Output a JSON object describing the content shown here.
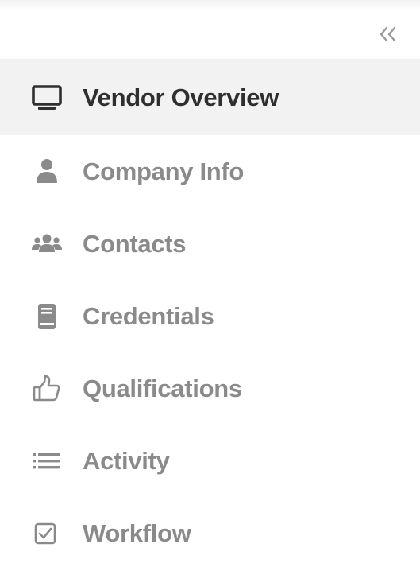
{
  "sidebar": {
    "collapse_icon": "double-chevron-left-icon",
    "items": [
      {
        "label": "Vendor Overview",
        "icon": "monitor-icon",
        "active": true
      },
      {
        "label": "Company Info",
        "icon": "user-icon",
        "active": false
      },
      {
        "label": "Contacts",
        "icon": "users-icon",
        "active": false
      },
      {
        "label": "Credentials",
        "icon": "book-icon",
        "active": false
      },
      {
        "label": "Qualifications",
        "icon": "thumbs-up-icon",
        "active": false
      },
      {
        "label": "Activity",
        "icon": "list-icon",
        "active": false
      },
      {
        "label": "Workflow",
        "icon": "checkbox-icon",
        "active": false
      }
    ]
  },
  "colors": {
    "active_text": "#2f2f2f",
    "inactive_text": "#8a8a8a",
    "active_background": "#f2f2f2",
    "icon_gray": "#8a8a8a"
  }
}
